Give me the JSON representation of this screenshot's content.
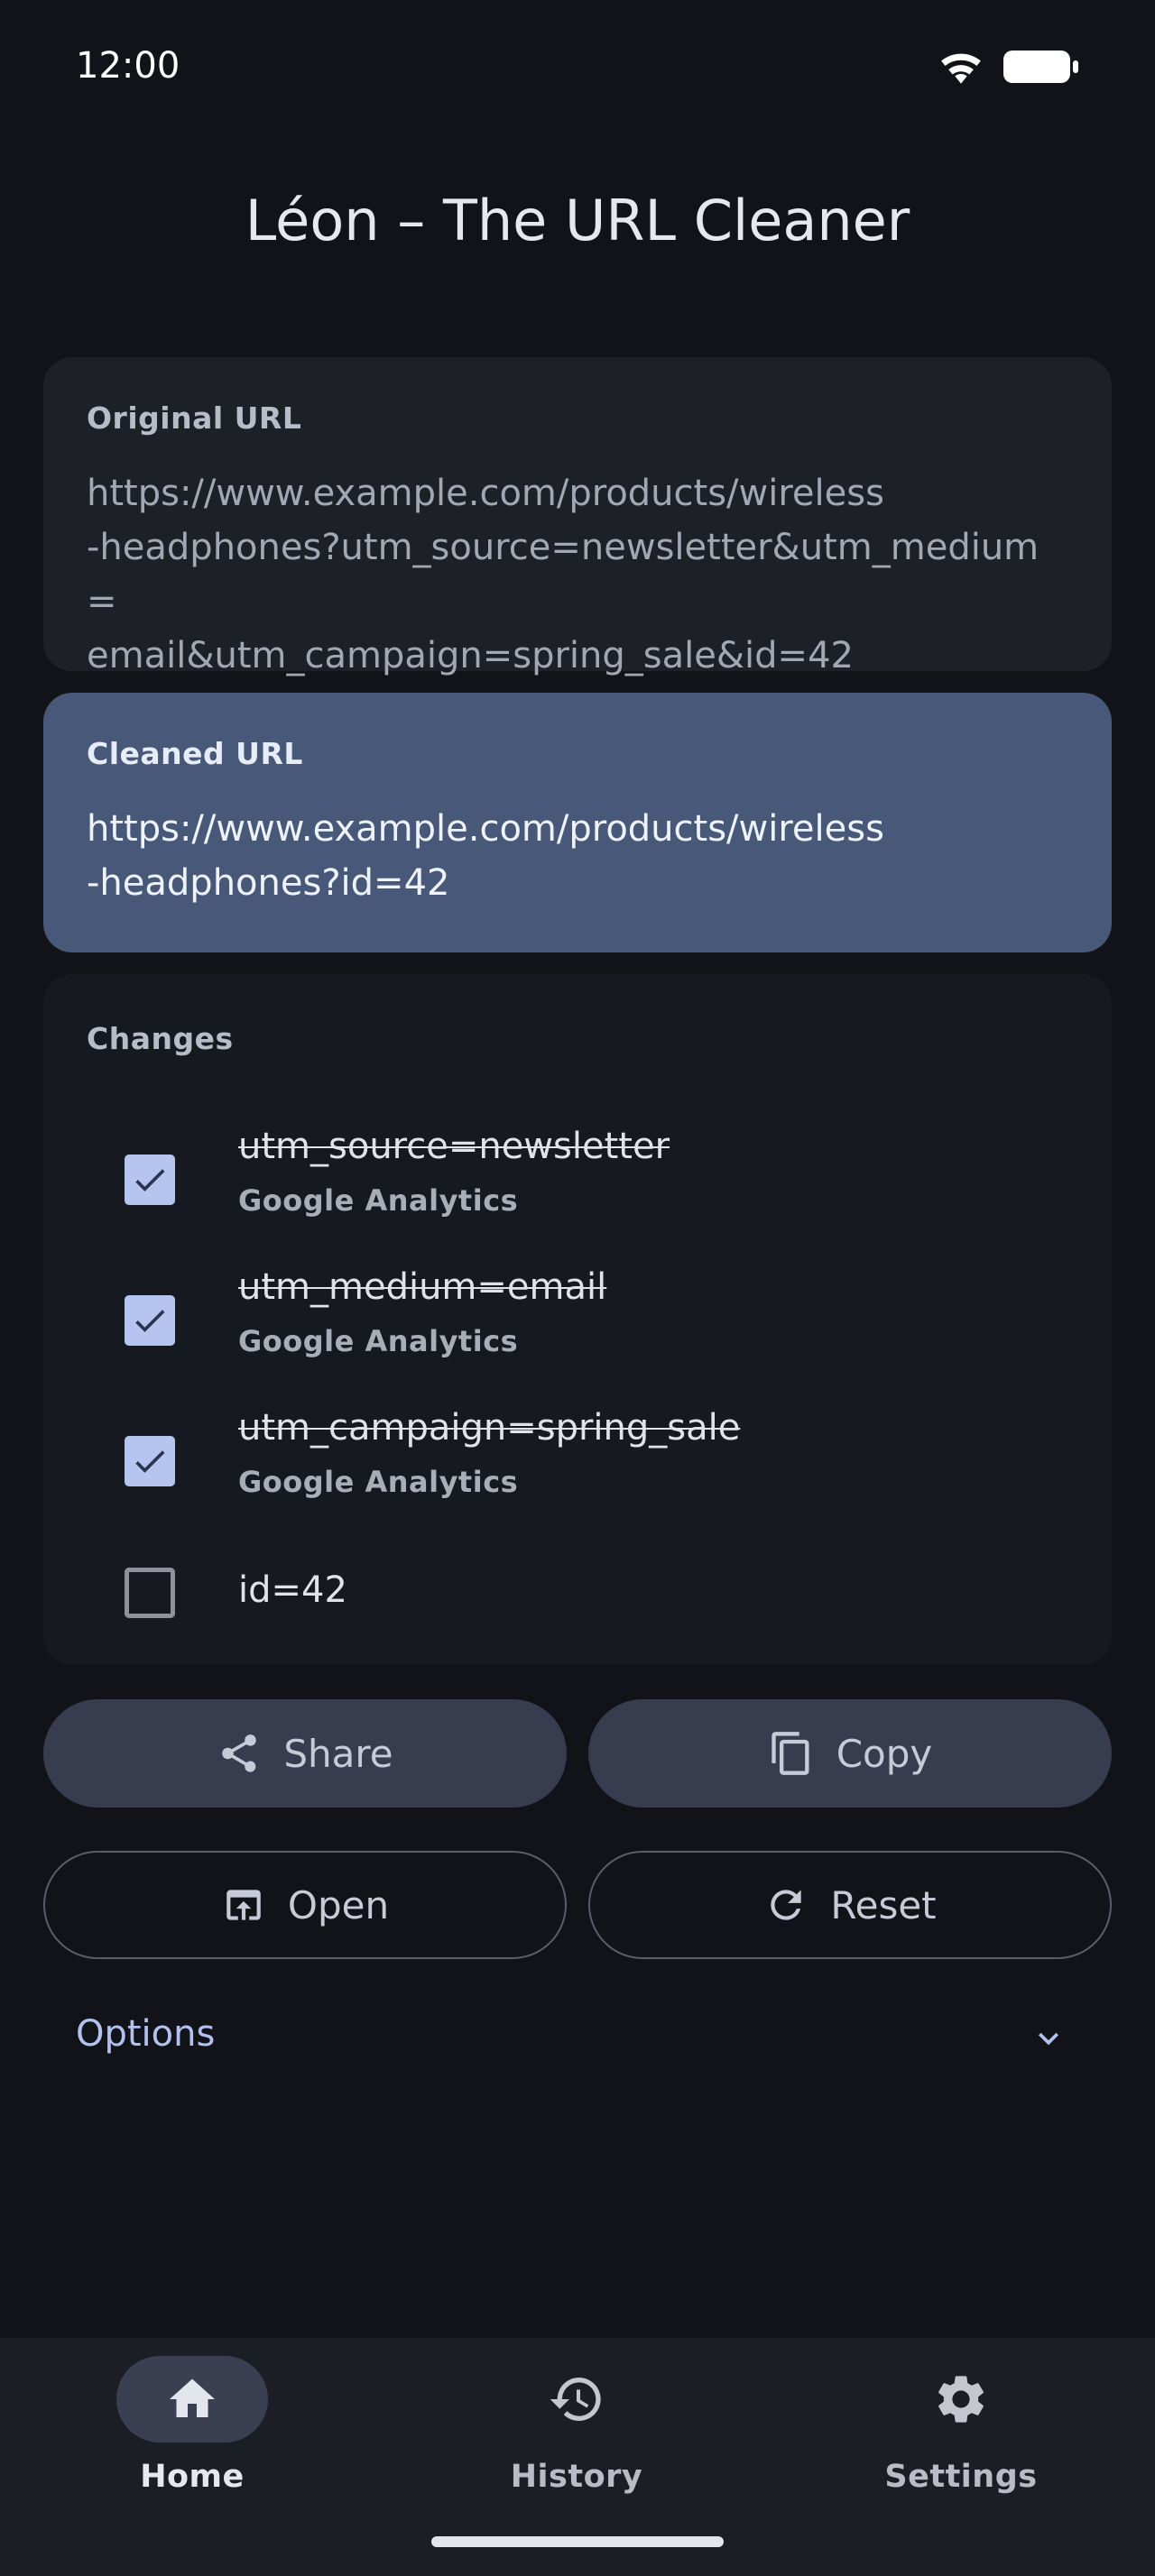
{
  "status_bar": {
    "time": "12:00"
  },
  "app": {
    "title": "Léon – The URL Cleaner"
  },
  "original": {
    "label": "Original URL",
    "url": "https://www.example.com/products/wireless\n-headphones?utm_source=newsletter&utm_medium=\nemail&utm_campaign=spring_sale&id=42"
  },
  "cleaned": {
    "label": "Cleaned URL",
    "url": "https://www.example.com/products/wireless\n-headphones?id=42"
  },
  "changes": {
    "title": "Changes",
    "items": [
      {
        "param": "utm_source=newsletter",
        "source": "Google Analytics",
        "checked": true
      },
      {
        "param": "utm_medium=email",
        "source": "Google Analytics",
        "checked": true
      },
      {
        "param": "utm_campaign=spring_sale",
        "source": "Google Analytics",
        "checked": true
      },
      {
        "param": "id=42",
        "source": "",
        "checked": false
      }
    ]
  },
  "actions": {
    "share": "Share",
    "copy": "Copy",
    "open": "Open",
    "reset": "Reset"
  },
  "options": {
    "label": "Options"
  },
  "nav": {
    "items": [
      {
        "label": "Home",
        "icon": "home-icon",
        "active": true
      },
      {
        "label": "History",
        "icon": "history-icon",
        "active": false
      },
      {
        "label": "Settings",
        "icon": "settings-icon",
        "active": false
      }
    ]
  },
  "colors": {
    "background": "#111318",
    "cleaned_card": "#475878",
    "accent": "#b6c4f0",
    "options_text": "#b2c2ef"
  }
}
